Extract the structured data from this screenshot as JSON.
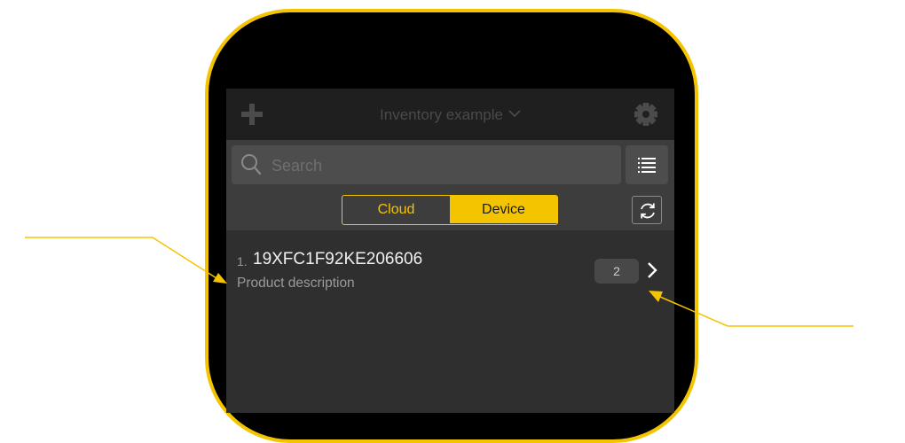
{
  "colors": {
    "accent": "#f5c400",
    "navbar_bg": "#1f1f1f",
    "toolbar_bg": "#3d3d3d",
    "list_bg": "#2f2f2f"
  },
  "navbar": {
    "title": "Inventory example",
    "add_icon": "plus-icon",
    "settings_icon": "gear-icon",
    "dropdown_icon": "chevron-down-icon"
  },
  "search": {
    "placeholder": "Search",
    "value": "",
    "icon": "search-icon",
    "view_toggle_icon": "list-icon"
  },
  "source_toggle": {
    "options": [
      "Cloud",
      "Device"
    ],
    "selected": "Device",
    "refresh_icon": "refresh-icon"
  },
  "items": [
    {
      "index": "1.",
      "title": "19XFC1F92KE206606",
      "description": "Product description",
      "count": "2"
    }
  ]
}
